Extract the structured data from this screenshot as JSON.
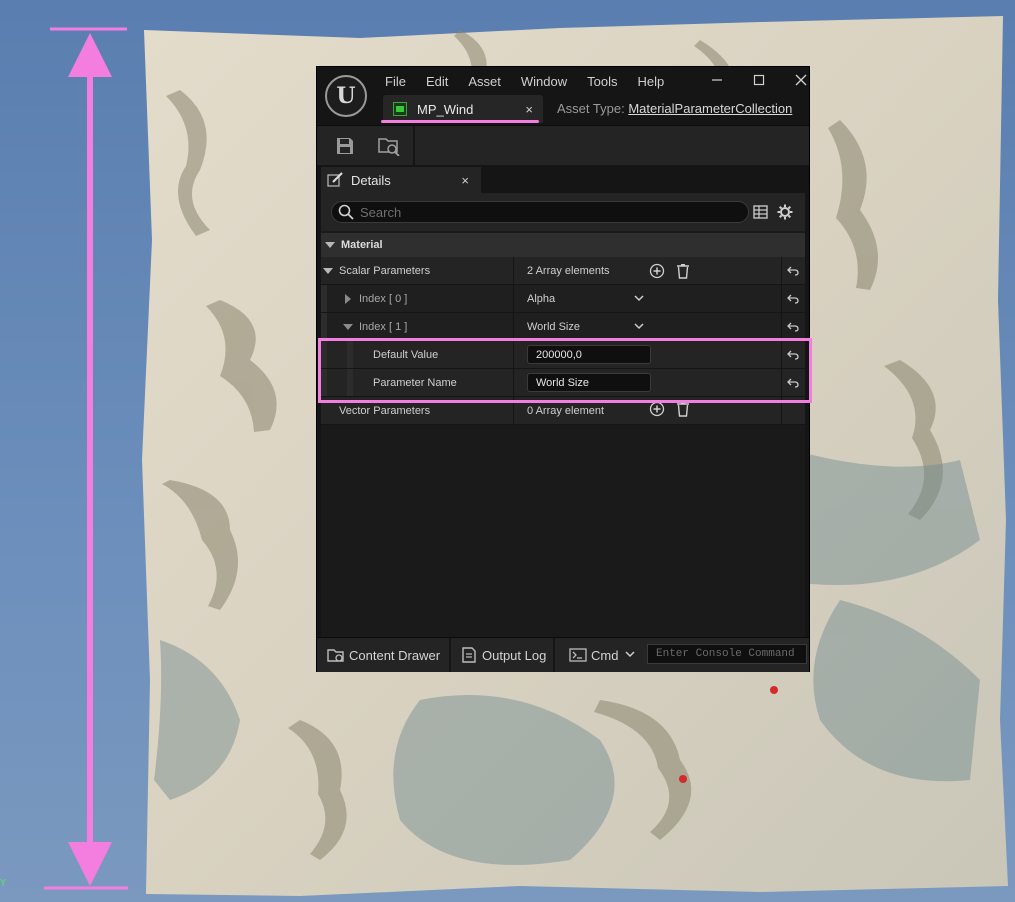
{
  "viewport": {
    "axis_label": "Y"
  },
  "window": {
    "menu": [
      "File",
      "Edit",
      "Asset",
      "Window",
      "Tools",
      "Help"
    ],
    "tab": {
      "label": "MP_Wind",
      "close": "×"
    },
    "asset_type": {
      "label": "Asset Type:",
      "value": "MaterialParameterCollection"
    }
  },
  "details": {
    "tab_label": "Details",
    "tab_close": "×",
    "search_placeholder": "Search",
    "category": "Material",
    "rows": {
      "scalar": {
        "name": "Scalar Parameters",
        "value": "2 Array elements"
      },
      "index0": {
        "name": "Index [ 0 ]",
        "value": "Alpha"
      },
      "index1": {
        "name": "Index [ 1 ]",
        "value": "World Size"
      },
      "default_value": {
        "name": "Default Value",
        "value": "200000,0"
      },
      "parameter_name": {
        "name": "Parameter Name",
        "value": "World Size"
      },
      "vector": {
        "name": "Vector Parameters",
        "value": "0 Array element"
      }
    }
  },
  "statusbar": {
    "content_drawer": "Content Drawer",
    "output_log": "Output Log",
    "cmd": "Cmd",
    "console_placeholder": "Enter Console Command"
  },
  "colors": {
    "highlight": "#f47ee0",
    "window_bg": "#151515",
    "panel_bg": "#242424"
  }
}
